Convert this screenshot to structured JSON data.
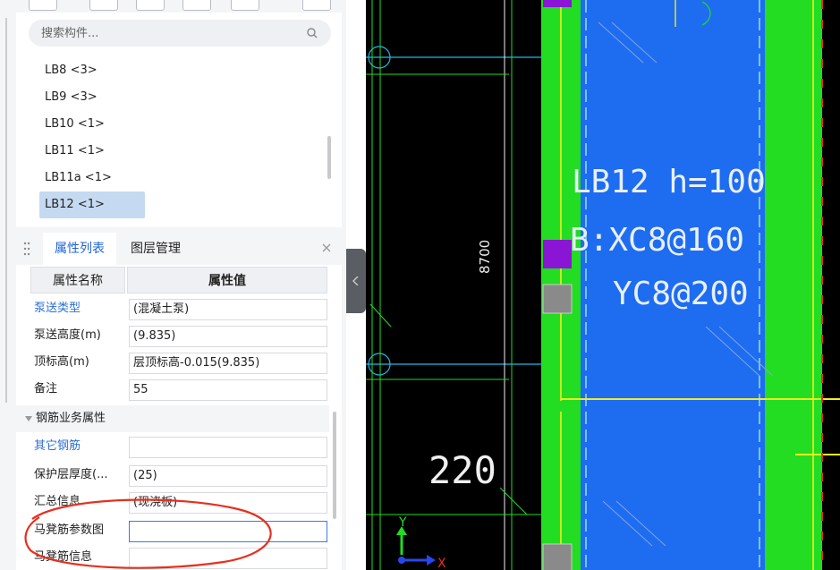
{
  "search": {
    "placeholder": "搜索构件..."
  },
  "components": [
    {
      "label": "LB8 <3>"
    },
    {
      "label": "LB9 <3>"
    },
    {
      "label": "LB10 <1>"
    },
    {
      "label": "LB11 <1>"
    },
    {
      "label": "LB11a <1>"
    },
    {
      "label": "LB12 <1>"
    }
  ],
  "tabs": {
    "active": "属性列表",
    "other": "图层管理"
  },
  "table": {
    "col_name": "属性名称",
    "col_value": "属性值"
  },
  "props": [
    {
      "label": "泵送类型",
      "value": "(混凝土泵)"
    },
    {
      "label": "泵送高度(m)",
      "value": "(9.835)"
    },
    {
      "label": "顶标高(m)",
      "value": "层顶标高-0.015(9.835)"
    },
    {
      "label": "备注",
      "value": "55"
    }
  ],
  "group": {
    "label": "钢筋业务属性"
  },
  "rebar_props": [
    {
      "label": "其它钢筋",
      "value": ""
    },
    {
      "label": "保护层厚度(...",
      "value": "(25)"
    },
    {
      "label": "汇总信息",
      "value": "(现浇板)"
    },
    {
      "label": "马凳筋参数图",
      "value": ""
    },
    {
      "label": "马凳筋信息",
      "value": ""
    }
  ],
  "cad": {
    "slab_label": "LB12 h=100",
    "rebar_b": "B:XC8@160",
    "rebar_y": "YC8@200",
    "dim_vertical": "8700",
    "dim_220": "220",
    "axis_y": "Y",
    "axis_x": "X"
  },
  "colors": {
    "accent": "#1f64d1",
    "selection": "#c5daf1",
    "cad_bg": "#000000",
    "slab_blue": "#1e6cf0",
    "beam_green": "#22dd22",
    "annotation_red": "#e53020"
  }
}
